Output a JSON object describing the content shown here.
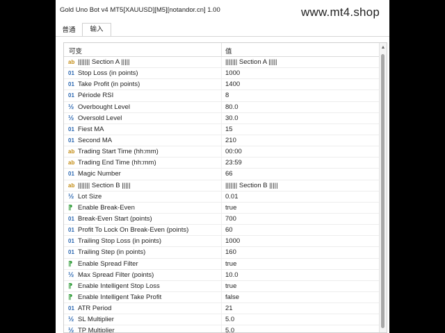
{
  "window": {
    "title": "Gold Uno Bot v4 MT5[XAUUSD][M5][notandor.cn] 1.00",
    "watermark": "www.mt4.shop"
  },
  "tabs": [
    {
      "label": "普通"
    },
    {
      "label": "输入"
    }
  ],
  "grid": {
    "headers": {
      "variable": "可变",
      "value": "值"
    },
    "rows": [
      {
        "icon": "ab",
        "type": "str",
        "name": "||||||| Section A |||||",
        "value": "||||||| Section A |||||"
      },
      {
        "icon": "01",
        "type": "int",
        "name": "Stop Loss (in points)",
        "value": "1000"
      },
      {
        "icon": "01",
        "type": "int",
        "name": "Take Profit (in points)",
        "value": "1400"
      },
      {
        "icon": "01",
        "type": "int",
        "name": "Période RSI",
        "value": "8"
      },
      {
        "icon": "½",
        "type": "dbl",
        "name": "Overbought Level",
        "value": "80.0"
      },
      {
        "icon": "½",
        "type": "dbl",
        "name": "Oversold Level",
        "value": "30.0"
      },
      {
        "icon": "01",
        "type": "int",
        "name": "Fiest MA",
        "value": "15"
      },
      {
        "icon": "01",
        "type": "int",
        "name": "Second MA",
        "value": "210"
      },
      {
        "icon": "ab",
        "type": "str",
        "name": "Trading Start Time (hh:mm)",
        "value": "00:00"
      },
      {
        "icon": "ab",
        "type": "str",
        "name": "Trading End Time (hh:mm)",
        "value": "23:59"
      },
      {
        "icon": "01",
        "type": "int",
        "name": "Magic Number",
        "value": "66"
      },
      {
        "icon": "ab",
        "type": "str",
        "name": "||||||| Section B |||||",
        "value": "||||||| Section B |||||"
      },
      {
        "icon": "½",
        "type": "dbl",
        "name": "Lot Size",
        "value": "0.01"
      },
      {
        "icon": "⁋",
        "type": "bool",
        "name": "Enable Break-Even",
        "value": "true"
      },
      {
        "icon": "01",
        "type": "int",
        "name": "Break-Even Start (points)",
        "value": "700"
      },
      {
        "icon": "01",
        "type": "int",
        "name": "Profit To Lock On Break-Even (points)",
        "value": "60"
      },
      {
        "icon": "01",
        "type": "int",
        "name": "Trailing Stop Loss (in points)",
        "value": "1000"
      },
      {
        "icon": "01",
        "type": "int",
        "name": "Trailing Step (in points)",
        "value": "160"
      },
      {
        "icon": "⁋",
        "type": "bool",
        "name": "Enable Spread Filter",
        "value": "true"
      },
      {
        "icon": "½",
        "type": "dbl",
        "name": "Max Spread Filter (points)",
        "value": "10.0"
      },
      {
        "icon": "⁋",
        "type": "bool",
        "name": "Enable Intelligent Stop Loss",
        "value": "true"
      },
      {
        "icon": "⁋",
        "type": "bool",
        "name": "Enable Intelligent Take Profit",
        "value": "false"
      },
      {
        "icon": "01",
        "type": "int",
        "name": "ATR Period",
        "value": "21"
      },
      {
        "icon": "½",
        "type": "dbl",
        "name": "SL Multiplier",
        "value": "5.0"
      },
      {
        "icon": "½",
        "type": "dbl",
        "name": "TP Multiplier",
        "value": "5.0"
      }
    ]
  },
  "icons": {
    "int": "integer-type-icon",
    "str": "string-type-icon",
    "dbl": "double-type-icon",
    "bool": "boolean-type-icon"
  }
}
